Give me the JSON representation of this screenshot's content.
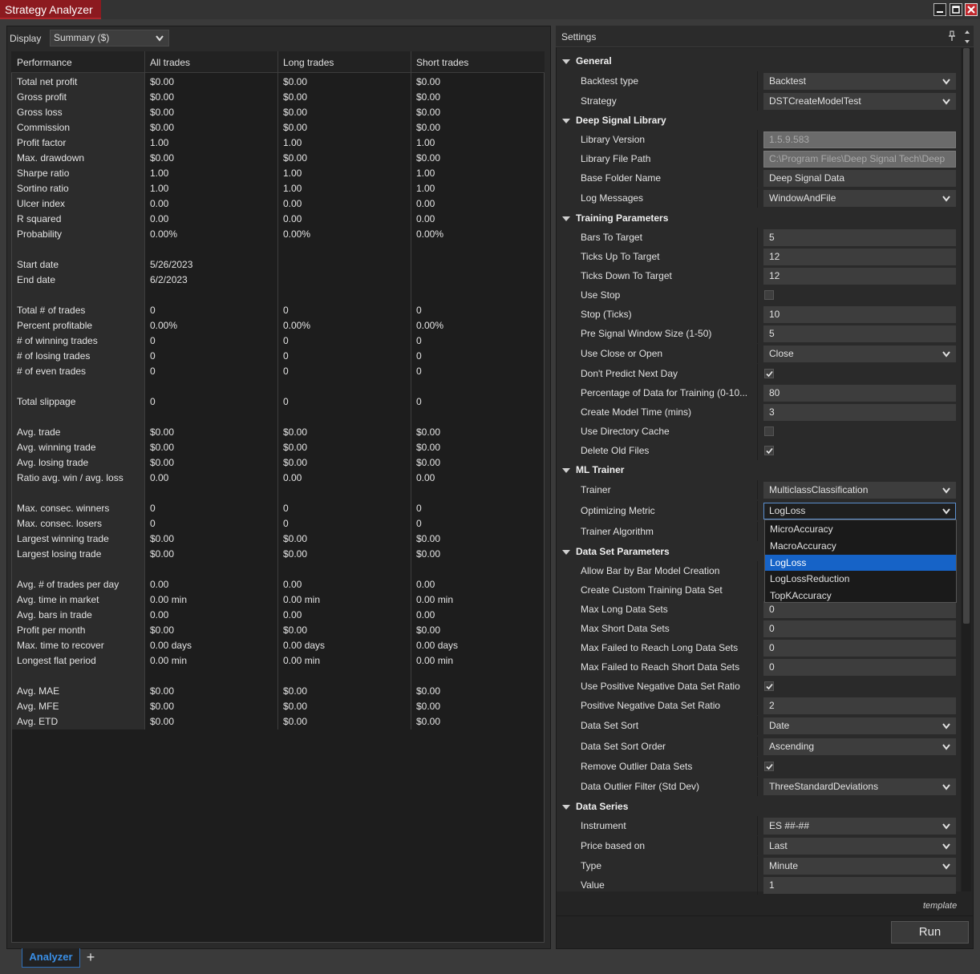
{
  "window": {
    "title": "Strategy Analyzer"
  },
  "display": {
    "label": "Display",
    "value": "Summary ($)"
  },
  "table": {
    "headers": [
      "Performance",
      "All trades",
      "Long trades",
      "Short trades"
    ],
    "rows": [
      {
        "label": "Total net profit",
        "all": "$0.00",
        "long": "$0.00",
        "short": "$0.00"
      },
      {
        "label": "Gross profit",
        "all": "$0.00",
        "long": "$0.00",
        "short": "$0.00"
      },
      {
        "label": "Gross loss",
        "all": "$0.00",
        "long": "$0.00",
        "short": "$0.00"
      },
      {
        "label": "Commission",
        "all": "$0.00",
        "long": "$0.00",
        "short": "$0.00"
      },
      {
        "label": "Profit factor",
        "all": "1.00",
        "long": "1.00",
        "short": "1.00"
      },
      {
        "label": "Max. drawdown",
        "all": "$0.00",
        "long": "$0.00",
        "short": "$0.00"
      },
      {
        "label": "Sharpe ratio",
        "all": "1.00",
        "long": "1.00",
        "short": "1.00"
      },
      {
        "label": "Sortino ratio",
        "all": "1.00",
        "long": "1.00",
        "short": "1.00"
      },
      {
        "label": "Ulcer index",
        "all": "0.00",
        "long": "0.00",
        "short": "0.00"
      },
      {
        "label": "R squared",
        "all": "0.00",
        "long": "0.00",
        "short": "0.00"
      },
      {
        "label": "Probability",
        "all": "0.00%",
        "long": "0.00%",
        "short": "0.00%"
      },
      {
        "label": "",
        "all": "",
        "long": "",
        "short": ""
      },
      {
        "label": "Start date",
        "all": "5/26/2023",
        "long": "",
        "short": ""
      },
      {
        "label": "End date",
        "all": "6/2/2023",
        "long": "",
        "short": ""
      },
      {
        "label": "",
        "all": "",
        "long": "",
        "short": ""
      },
      {
        "label": "Total # of trades",
        "all": "0",
        "long": "0",
        "short": "0"
      },
      {
        "label": "Percent profitable",
        "all": "0.00%",
        "long": "0.00%",
        "short": "0.00%"
      },
      {
        "label": "# of winning trades",
        "all": "0",
        "long": "0",
        "short": "0"
      },
      {
        "label": "# of losing trades",
        "all": "0",
        "long": "0",
        "short": "0"
      },
      {
        "label": "# of even trades",
        "all": "0",
        "long": "0",
        "short": "0"
      },
      {
        "label": "",
        "all": "",
        "long": "",
        "short": ""
      },
      {
        "label": "Total slippage",
        "all": "0",
        "long": "0",
        "short": "0"
      },
      {
        "label": "",
        "all": "",
        "long": "",
        "short": ""
      },
      {
        "label": "Avg. trade",
        "all": "$0.00",
        "long": "$0.00",
        "short": "$0.00"
      },
      {
        "label": "Avg. winning trade",
        "all": "$0.00",
        "long": "$0.00",
        "short": "$0.00"
      },
      {
        "label": "Avg. losing trade",
        "all": "$0.00",
        "long": "$0.00",
        "short": "$0.00"
      },
      {
        "label": "Ratio avg. win / avg. loss",
        "all": "0.00",
        "long": "0.00",
        "short": "0.00"
      },
      {
        "label": "",
        "all": "",
        "long": "",
        "short": ""
      },
      {
        "label": "Max. consec. winners",
        "all": "0",
        "long": "0",
        "short": "0"
      },
      {
        "label": "Max. consec. losers",
        "all": "0",
        "long": "0",
        "short": "0"
      },
      {
        "label": "Largest winning trade",
        "all": "$0.00",
        "long": "$0.00",
        "short": "$0.00"
      },
      {
        "label": "Largest losing trade",
        "all": "$0.00",
        "long": "$0.00",
        "short": "$0.00"
      },
      {
        "label": "",
        "all": "",
        "long": "",
        "short": ""
      },
      {
        "label": "Avg. # of trades per day",
        "all": "0.00",
        "long": "0.00",
        "short": "0.00"
      },
      {
        "label": "Avg. time in market",
        "all": "0.00 min",
        "long": "0.00 min",
        "short": "0.00 min"
      },
      {
        "label": "Avg. bars in trade",
        "all": "0.00",
        "long": "0.00",
        "short": "0.00"
      },
      {
        "label": "Profit per month",
        "all": "$0.00",
        "long": "$0.00",
        "short": "$0.00"
      },
      {
        "label": "Max. time to recover",
        "all": "0.00 days",
        "long": "0.00 days",
        "short": "0.00 days"
      },
      {
        "label": "Longest flat period",
        "all": "0.00 min",
        "long": "0.00 min",
        "short": "0.00 min"
      },
      {
        "label": "",
        "all": "",
        "long": "",
        "short": ""
      },
      {
        "label": "Avg. MAE",
        "all": "$0.00",
        "long": "$0.00",
        "short": "$0.00"
      },
      {
        "label": "Avg. MFE",
        "all": "$0.00",
        "long": "$0.00",
        "short": "$0.00"
      },
      {
        "label": "Avg. ETD",
        "all": "$0.00",
        "long": "$0.00",
        "short": "$0.00"
      }
    ]
  },
  "settings": {
    "title": "Settings",
    "rows": [
      {
        "kind": "category",
        "label": "General"
      },
      {
        "kind": "select",
        "label": "Backtest type",
        "value": "Backtest"
      },
      {
        "kind": "select",
        "label": "Strategy",
        "value": "DSTCreateModelTest"
      },
      {
        "kind": "category",
        "label": "Deep Signal Library"
      },
      {
        "kind": "readonly",
        "label": "Library Version",
        "value": "1.5.9.583"
      },
      {
        "kind": "readonly",
        "label": "Library File Path",
        "value": "C:\\Program Files\\Deep Signal Tech\\Deep"
      },
      {
        "kind": "text",
        "label": "Base Folder Name",
        "value": "Deep Signal Data"
      },
      {
        "kind": "select",
        "label": "Log Messages",
        "value": "WindowAndFile"
      },
      {
        "kind": "category",
        "label": "Training Parameters"
      },
      {
        "kind": "text",
        "label": "Bars To Target",
        "value": "5"
      },
      {
        "kind": "text",
        "label": "Ticks Up To Target",
        "value": "12"
      },
      {
        "kind": "text",
        "label": "Ticks Down To Target",
        "value": "12"
      },
      {
        "kind": "check",
        "label": "Use Stop",
        "checked": false
      },
      {
        "kind": "text",
        "label": "Stop (Ticks)",
        "value": "10"
      },
      {
        "kind": "text",
        "label": "Pre Signal Window Size (1-50)",
        "value": "5"
      },
      {
        "kind": "select",
        "label": "Use Close or Open",
        "value": "Close"
      },
      {
        "kind": "check",
        "label": "Don't Predict Next Day",
        "checked": true
      },
      {
        "kind": "text",
        "label": "Percentage of Data for Training (0-10...",
        "value": "80"
      },
      {
        "kind": "text",
        "label": "Create Model Time (mins)",
        "value": "3"
      },
      {
        "kind": "check",
        "label": "Use Directory Cache",
        "checked": false
      },
      {
        "kind": "check",
        "label": "Delete Old Files",
        "checked": true
      },
      {
        "kind": "category",
        "label": "ML Trainer"
      },
      {
        "kind": "select",
        "label": "Trainer",
        "value": "MulticlassClassification"
      },
      {
        "kind": "open",
        "label": "Optimizing Metric",
        "value": "LogLoss"
      },
      {
        "kind": "hidden",
        "label": "Trainer Algorithm"
      },
      {
        "kind": "category",
        "label": "Data Set Parameters"
      },
      {
        "kind": "hidden",
        "label": "Allow Bar by Bar Model Creation"
      },
      {
        "kind": "hidden",
        "label": "Create Custom Training Data Set"
      },
      {
        "kind": "text",
        "label": "Max Long Data Sets",
        "value": "0"
      },
      {
        "kind": "text",
        "label": "Max Short Data Sets",
        "value": "0"
      },
      {
        "kind": "text",
        "label": "Max Failed to Reach Long Data Sets",
        "value": "0"
      },
      {
        "kind": "text",
        "label": "Max Failed to Reach Short Data Sets",
        "value": "0"
      },
      {
        "kind": "check",
        "label": "Use Positive Negative Data Set Ratio",
        "checked": true
      },
      {
        "kind": "text",
        "label": "Positive Negative Data Set Ratio",
        "value": "2"
      },
      {
        "kind": "select",
        "label": "Data Set Sort",
        "value": "Date"
      },
      {
        "kind": "select",
        "label": "Data Set Sort Order",
        "value": "Ascending"
      },
      {
        "kind": "check",
        "label": "Remove Outlier Data Sets",
        "checked": true
      },
      {
        "kind": "select",
        "label": "Data Outlier Filter (Std Dev)",
        "value": "ThreeStandardDeviations"
      },
      {
        "kind": "category",
        "label": "Data Series"
      },
      {
        "kind": "select",
        "label": "Instrument",
        "value": "ES ##-##"
      },
      {
        "kind": "select",
        "label": "Price based on",
        "value": "Last"
      },
      {
        "kind": "select",
        "label": "Type",
        "value": "Minute"
      },
      {
        "kind": "text",
        "label": "Value",
        "value": "1"
      }
    ],
    "dropdown_options": [
      "MicroAccuracy",
      "MacroAccuracy",
      "LogLoss",
      "LogLossReduction",
      "TopKAccuracy"
    ],
    "dropdown_selected": "LogLoss",
    "template_label": "template",
    "run_label": "Run"
  },
  "tabs": {
    "active": "Analyzer",
    "add": "+"
  },
  "colors": {
    "title_tab": "#8c1a1f",
    "accent_blue": "#1663c7",
    "tab_text": "#3a8fe6"
  }
}
